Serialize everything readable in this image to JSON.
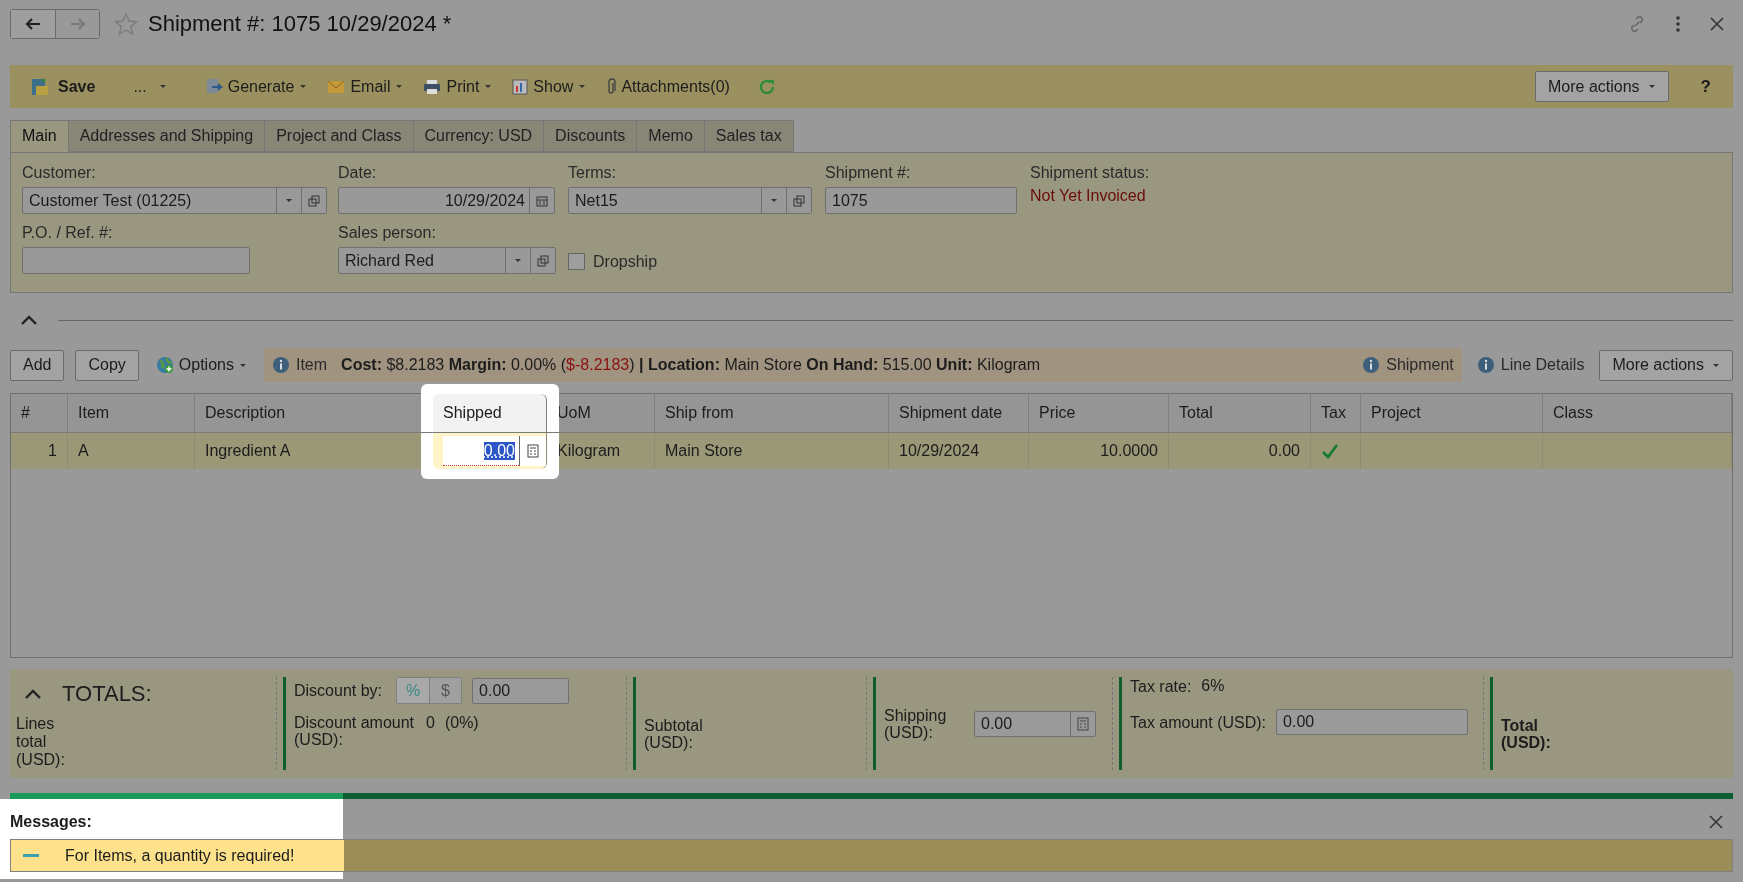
{
  "header": {
    "title": "Shipment #: 1075 10/29/2024 *"
  },
  "toolbar": {
    "save": "Save",
    "more": "...",
    "menus": [
      {
        "label": "Generate",
        "kind": "generate"
      },
      {
        "label": "Email",
        "kind": "email"
      },
      {
        "label": "Print",
        "kind": "print"
      },
      {
        "label": "Show",
        "kind": "show"
      }
    ],
    "attachments": "Attachments(0)",
    "more_actions": "More actions",
    "help": "?"
  },
  "tabs": [
    {
      "label": "Main",
      "selected": true
    },
    {
      "label": "Addresses and Shipping",
      "selected": false
    },
    {
      "label": "Project and Class",
      "selected": false
    },
    {
      "label": "Currency: USD",
      "selected": false
    },
    {
      "label": "Discounts",
      "selected": false
    },
    {
      "label": "Memo",
      "selected": false
    },
    {
      "label": "Sales tax",
      "selected": false
    }
  ],
  "form": {
    "customer": {
      "label": "Customer:",
      "value": "Customer Test (01225)"
    },
    "date": {
      "label": "Date:",
      "value": "10/29/2024"
    },
    "terms": {
      "label": "Terms:",
      "value": "Net15"
    },
    "shipment_number": {
      "label": "Shipment #:",
      "value": "1075"
    },
    "status": {
      "label": "Shipment status:",
      "value": "Not Yet Invoiced"
    },
    "po_ref": {
      "label": "P.O. / Ref. #:"
    },
    "sales_person": {
      "label": "Sales person:",
      "value": "Richard Red"
    },
    "dropship": {
      "label": "Dropship",
      "checked": false
    }
  },
  "grid_toolbar": {
    "add": "Add",
    "copy": "Copy",
    "options": "Options",
    "item_link": "Item",
    "info": {
      "before": "**Cost:** $8.2183 **Margin:** 0.00% (",
      "negative": "$-8.2183",
      "after": ") **| Location:** Main Store **On Hand:** 515.00 **Unit:** Kilogram"
    },
    "shipment_link": "Shipment",
    "line_details": "Line Details",
    "more_actions": "More actions"
  },
  "table": {
    "columns": [
      {
        "label": "#",
        "highlighted": false
      },
      {
        "label": "Item",
        "highlighted": false
      },
      {
        "label": "Description",
        "highlighted": false
      },
      {
        "label": "Shipped",
        "highlighted": true
      },
      {
        "label": "UoM",
        "highlighted": false
      },
      {
        "label": "Ship from",
        "highlighted": false
      },
      {
        "label": "Shipment date",
        "highlighted": false
      },
      {
        "label": "Price",
        "highlighted": false
      },
      {
        "label": "Total",
        "highlighted": false
      },
      {
        "label": "Tax",
        "highlighted": false
      },
      {
        "label": "Project",
        "highlighted": false
      },
      {
        "label": "Class",
        "highlighted": false
      }
    ],
    "rows": [
      {
        "selected": true,
        "number": "1",
        "item": "A",
        "description": "Ingredient A",
        "shipped": "0.00",
        "uom": "Kilogram",
        "ship_from": "Main Store",
        "shipment_date": "10/29/2024",
        "price": "10.0000",
        "total": "0.00",
        "tax": true
      }
    ]
  },
  "totals": {
    "title": "TOTALS:",
    "lines_total": "Lines total (USD):",
    "discount_by": "Discount by:",
    "discount_modes": [
      {
        "label": "%",
        "selected": true
      },
      {
        "label": "$",
        "selected": false
      }
    ],
    "discount_value": "0.00",
    "discount_amount_label": "Discount amount (USD):",
    "discount_amount": "0",
    "discount_percent": "(0%)",
    "subtotal": "Subtotal (USD):",
    "shipping_label": "Shipping (USD):",
    "shipping_value": "0.00",
    "tax_rate_label": "Tax rate:",
    "tax_rate": "6%",
    "tax_amount_label": "Tax amount (USD):",
    "tax_amount": "0.00",
    "total_label": "Total (USD):"
  },
  "messages": {
    "title": "Messages:",
    "items": [
      {
        "text": "For Items, a quantity is required!"
      }
    ]
  }
}
